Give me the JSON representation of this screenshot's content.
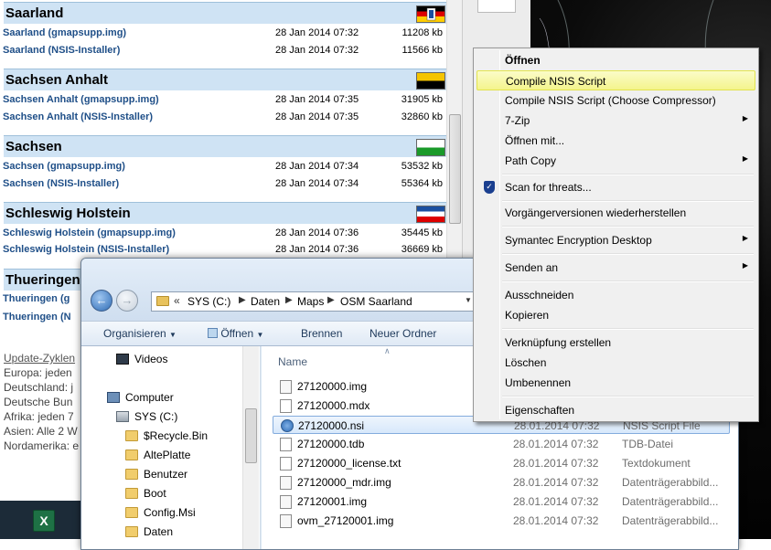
{
  "webpage": {
    "regions": [
      {
        "name": "Saarland",
        "files": [
          {
            "name": "Saarland (gmapsupp.img)",
            "date": "28 Jan 2014 07:32",
            "size": "11208 kb"
          },
          {
            "name": "Saarland (NSIS-Installer)",
            "date": "28 Jan 2014 07:32",
            "size": "11566 kb"
          }
        ]
      },
      {
        "name": "Sachsen Anhalt",
        "files": [
          {
            "name": "Sachsen Anhalt (gmapsupp.img)",
            "date": "28 Jan 2014 07:35",
            "size": "31905 kb"
          },
          {
            "name": "Sachsen Anhalt (NSIS-Installer)",
            "date": "28 Jan 2014 07:35",
            "size": "32860 kb"
          }
        ]
      },
      {
        "name": "Sachsen",
        "files": [
          {
            "name": "Sachsen (gmapsupp.img)",
            "date": "28 Jan 2014 07:34",
            "size": "53532 kb"
          },
          {
            "name": "Sachsen (NSIS-Installer)",
            "date": "28 Jan 2014 07:34",
            "size": "55364 kb"
          }
        ]
      },
      {
        "name": "Schleswig Holstein",
        "files": [
          {
            "name": "Schleswig Holstein (gmapsupp.img)",
            "date": "28 Jan 2014 07:36",
            "size": "35445 kb"
          },
          {
            "name": "Schleswig Holstein (NSIS-Installer)",
            "date": "28 Jan 2014 07:36",
            "size": "36669 kb"
          }
        ]
      },
      {
        "name": "Thueringen",
        "files": [
          {
            "name": "Thueringen (g",
            "date": "",
            "size": ""
          },
          {
            "name": "Thueringen (N",
            "date": "",
            "size": ""
          }
        ]
      }
    ],
    "text_lines": [
      "Update-Zyklen",
      "Europa: jeden",
      "Deutschland: j",
      "Deutsche Bun",
      "Afrika: jeden 7",
      "Asien: Alle 2 W",
      "Nordamerika: e"
    ]
  },
  "explorer": {
    "address": {
      "root_marker": "«",
      "crumbs": [
        "SYS (C:)",
        "Daten",
        "Maps",
        "OSM Saarland"
      ]
    },
    "toolbar": {
      "organize": "Organisieren",
      "open": "Öffnen",
      "burn": "Brennen",
      "new_folder": "Neuer Ordner"
    },
    "nav": {
      "videos": "Videos",
      "computer": "Computer",
      "drive": "SYS (C:)",
      "folders": [
        "$Recycle.Bin",
        "AltePlatte",
        "Benutzer",
        "Boot",
        "Config.Msi",
        "Daten"
      ]
    },
    "column_name": "Name",
    "files": [
      {
        "name": "27120000.img",
        "date": "",
        "type": "",
        "icon": "img-file-icon"
      },
      {
        "name": "27120000.mdx",
        "date": "",
        "type": "",
        "icon": "file-icon"
      },
      {
        "name": "27120000.nsi",
        "date": "28.01.2014 07:32",
        "type": "NSIS Script File",
        "icon": "nsis-script-icon",
        "selected": true
      },
      {
        "name": "27120000.tdb",
        "date": "28.01.2014 07:32",
        "type": "TDB-Datei",
        "icon": "file-icon"
      },
      {
        "name": "27120000_license.txt",
        "date": "28.01.2014 07:32",
        "type": "Textdokument",
        "icon": "file-icon"
      },
      {
        "name": "27120000_mdr.img",
        "date": "28.01.2014 07:32",
        "type": "Datenträgerabbild...",
        "icon": "img-file-icon"
      },
      {
        "name": "27120001.img",
        "date": "28.01.2014 07:32",
        "type": "Datenträgerabbild...",
        "icon": "img-file-icon"
      },
      {
        "name": "ovm_27120001.img",
        "date": "28.01.2014 07:32",
        "type": "Datenträgerabbild...",
        "icon": "img-file-icon"
      }
    ]
  },
  "context_menu": {
    "items": [
      {
        "label": "Öffnen",
        "bold": true
      },
      {
        "label": "Compile NSIS Script",
        "highlighted": true
      },
      {
        "label": "Compile NSIS Script (Choose Compressor)"
      },
      {
        "label": "7-Zip",
        "submenu": true
      },
      {
        "label": "Öffnen mit..."
      },
      {
        "label": "Path Copy",
        "submenu": true
      },
      {
        "label": "Scan for threats...",
        "icon": "shield-icon"
      },
      {
        "label": "Vorgängerversionen wiederherstellen"
      },
      {
        "label": "Symantec Encryption Desktop",
        "submenu": true
      },
      {
        "label": "Senden an",
        "submenu": true
      },
      {
        "label": "Ausschneiden"
      },
      {
        "label": "Kopieren"
      },
      {
        "label": "Verknüpfung erstellen"
      },
      {
        "label": "Löschen"
      },
      {
        "label": "Umbenennen"
      },
      {
        "label": "Eigenschaften"
      }
    ]
  },
  "colors": {
    "highlight": "#f4f48c",
    "link": "#1f4f88",
    "region_header": "#cfe3f4"
  }
}
